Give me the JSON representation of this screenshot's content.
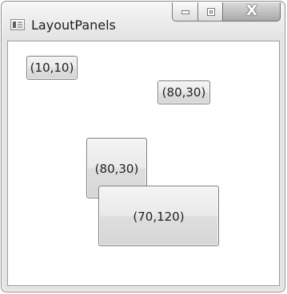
{
  "window": {
    "title": "LayoutPanels"
  },
  "controls": {
    "close_glyph": "X"
  },
  "canvas": {
    "buttons": [
      {
        "label": "(10,10)"
      },
      {
        "label": "(80,30)"
      },
      {
        "label": "(80,30)"
      },
      {
        "label": "(70,120)"
      }
    ]
  },
  "colors": {
    "window_border": "#8a8a8a",
    "client_border": "#9d9d9d",
    "button_border": "#7d7d7d",
    "close_button": "#a9a9a9"
  },
  "icons": {
    "app": "app-window-icon",
    "minimize": "minimize-icon",
    "maximize": "maximize-icon",
    "close": "close-icon"
  }
}
